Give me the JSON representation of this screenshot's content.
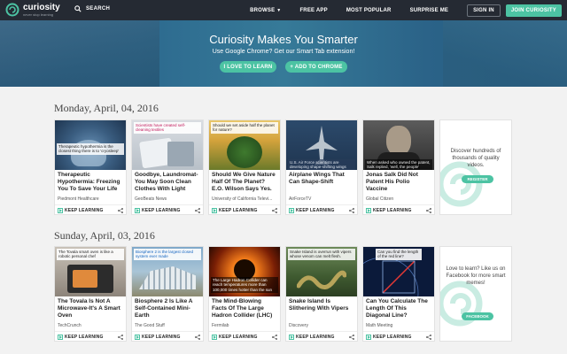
{
  "nav": {
    "logo_name": "curiosity",
    "logo_tagline": "never stop learning",
    "search_label": "SEARCH",
    "browse_label": "BROWSE",
    "free_app_label": "FREE APP",
    "most_popular_label": "MOST POPULAR",
    "surprise_label": "SURPRISE ME",
    "signin_label": "SIGN IN",
    "join_label": "JOIN CURIOSITY",
    "accent_color": "#4cc3a3"
  },
  "hero": {
    "title": "Curiosity Makes You Smarter",
    "subtitle": "Use Google Chrome? Get our Smart Tab extension!",
    "btn_love": "I LOVE TO LEARN",
    "btn_add": "+ ADD TO CHROME"
  },
  "sections": [
    {
      "date": "Monday, April, 04, 2016",
      "cards": [
        {
          "caption": "Therapeutic hypothermia is the closest thing there is to 'cryosleep'",
          "title": "Therapeutic Hypothermia: Freezing You To Save Your Life",
          "source": "Piedmont Healthcare",
          "keep": "KEEP LEARNING"
        },
        {
          "caption": "Scientists have created self-cleaning textiles",
          "title": "Goodbye, Laundromat- You May Soon Clean Clothes With Light",
          "source": "GeoBeats News",
          "keep": "KEEP LEARNING"
        },
        {
          "caption": "Should we set aside half the planet for nature?",
          "title": "Should We Give Nature Half Of The Planet? E.O. Wilson Says Yes.",
          "source": "University of California Televi...",
          "keep": "KEEP LEARNING"
        },
        {
          "caption": "U.S. Air Force scientists are developing shape-shifting wings",
          "title": "Airplane Wings That Can Shape-Shift",
          "source": "AirForceTV",
          "keep": "KEEP LEARNING"
        },
        {
          "caption": "When asked who owned the patent, Salk replied, 'well, the people'",
          "title": "Jonas Salk Did Not Patent His Polio Vaccine",
          "source": "Global Citizen",
          "keep": "KEEP LEARNING"
        }
      ],
      "promo": {
        "text": "Discover hundreds of thousands of quality videos.",
        "button": "REGISTER"
      }
    },
    {
      "date": "Sunday, April, 03, 2016",
      "cards": [
        {
          "caption": "The Tovala smart oven is like a robotic personal chef",
          "title": "The Tovala Is Not A Microwave-It's A Smart Oven",
          "source": "TechCrunch",
          "keep": "KEEP LEARNING"
        },
        {
          "caption": "Biosphere 2 is the largest closed system ever made",
          "title": "Biosphere 2 Is Like A Self-Contained Mini-Earth",
          "source": "The Good Stuff",
          "keep": "KEEP LEARNING"
        },
        {
          "caption": "The Large Hadron Collider can reach temperatures more than 100,000 times hotter than the sun",
          "title": "The Mind-Blowing Facts Of The Large Hadron Collider (LHC)",
          "source": "Fermilab",
          "keep": "KEEP LEARNING"
        },
        {
          "caption": "Snake Island is overrun with vipers whose venom can melt flesh.",
          "title": "Snake Island Is Slithering With Vipers",
          "source": "Discovery",
          "keep": "KEEP LEARNING"
        },
        {
          "caption": "Can you find the length of the red line?",
          "title": "Can You Calculate The Length Of This Diagonal Line?",
          "source": "Math Meeting",
          "keep": "KEEP LEARNING"
        }
      ],
      "promo": {
        "text": "Love to learn? Like us on Facebook for more smart memes!",
        "button": "FACEBOOK"
      }
    }
  ]
}
